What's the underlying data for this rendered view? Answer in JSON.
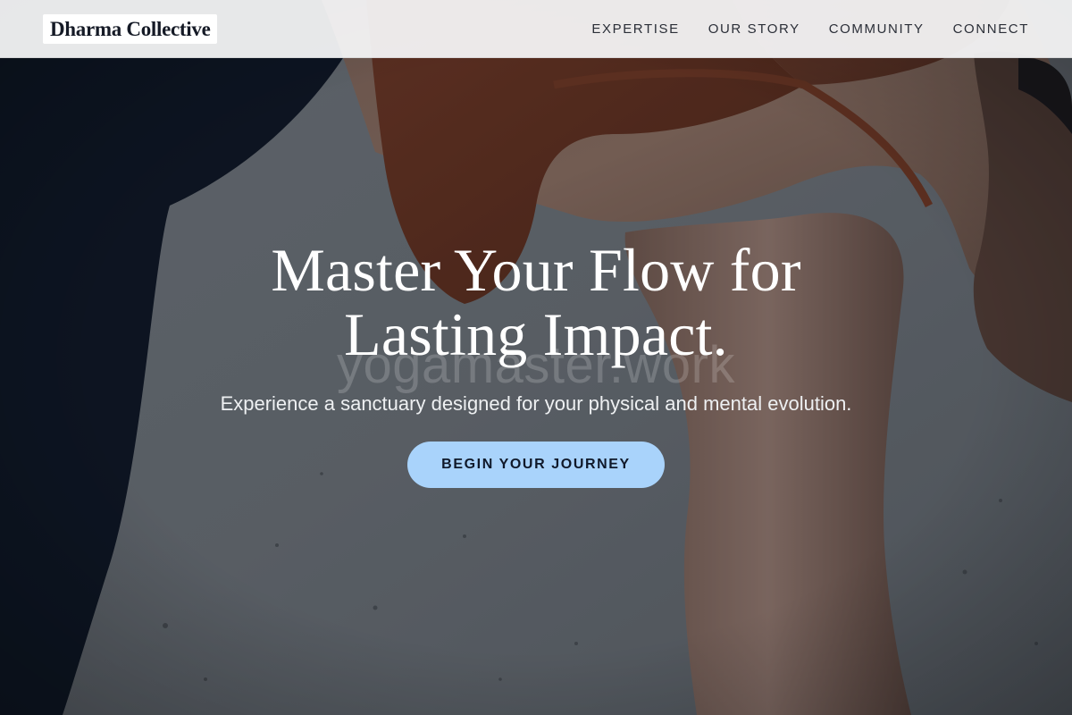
{
  "brand": {
    "name": "Dharma Collective"
  },
  "nav": {
    "items": [
      {
        "label": "EXPERTISE"
      },
      {
        "label": "OUR STORY"
      },
      {
        "label": "COMMUNITY"
      },
      {
        "label": "CONNECT"
      }
    ]
  },
  "hero": {
    "headline_line1": "Master Your Flow for",
    "headline_line2": "Lasting Impact.",
    "watermark": "yogamaster.work",
    "subtitle": "Experience a sanctuary designed for your physical and mental evolution.",
    "cta_label": "BEGIN YOUR JOURNEY",
    "background_image": "yoga-practitioner-in-rust-top-bending-forward-against-grey-concrete-wall"
  },
  "colors": {
    "nav_background": "#f5f5f6",
    "cta_background": "#a9d3fb",
    "cta_text": "#10192a",
    "headline": "#ffffff"
  }
}
